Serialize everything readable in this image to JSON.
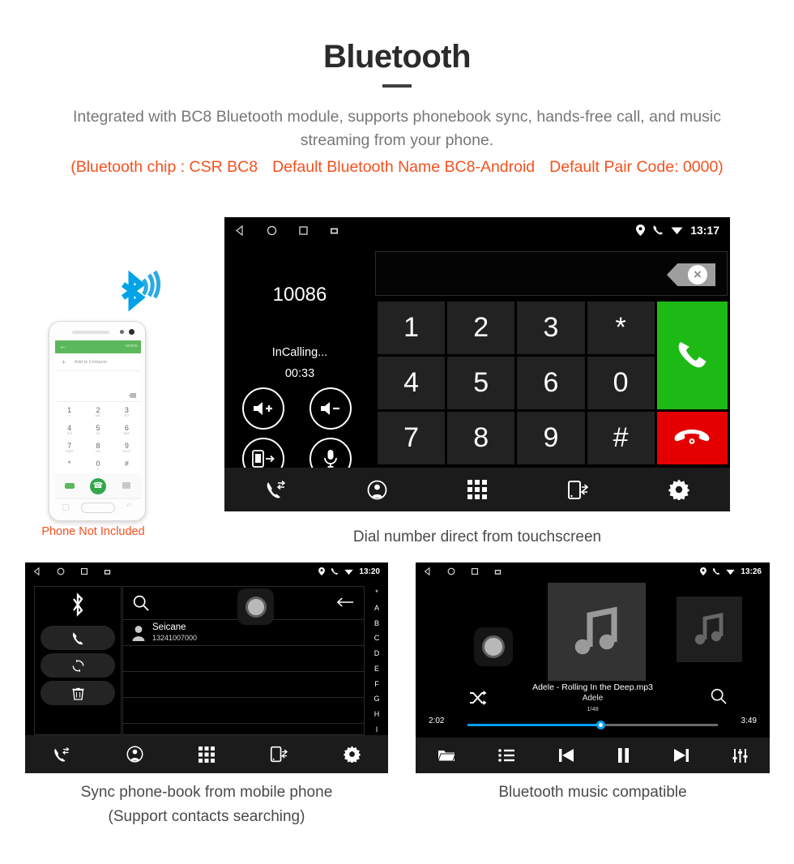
{
  "header": {
    "title": "Bluetooth",
    "description": "Integrated with BC8 Bluetooth module, supports phonebook sync, hands-free call, and music streaming from your phone.",
    "spec_part1": "(Bluetooth chip : CSR BC8",
    "spec_part2": "Default Bluetooth Name BC8-Android",
    "spec_part3": "Default Pair Code: 0000)",
    "accent_color": "#f4511e",
    "text_color": "#777777"
  },
  "phone_mockup": {
    "caption": "Phone Not Included",
    "screen": {
      "more_label": "MORE",
      "back_glyph": "←",
      "add_contact_plus": "+",
      "add_contact_label": "Add to Contacts",
      "keys": [
        {
          "digit": "1",
          "sub": "∞"
        },
        {
          "digit": "2",
          "sub": "ABC"
        },
        {
          "digit": "3",
          "sub": "DEF"
        },
        {
          "digit": "4",
          "sub": "GHI"
        },
        {
          "digit": "5",
          "sub": "JKL"
        },
        {
          "digit": "6",
          "sub": "MNO"
        },
        {
          "digit": "7",
          "sub": "PQRS"
        },
        {
          "digit": "8",
          "sub": "TUV"
        },
        {
          "digit": "9",
          "sub": "WXYZ"
        },
        {
          "digit": "*",
          "sub": ""
        },
        {
          "digit": "0",
          "sub": "+"
        },
        {
          "digit": "#",
          "sub": ""
        }
      ]
    }
  },
  "dial_screen": {
    "caption": "Dial number direct from touchscreen",
    "statusbar": {
      "time": "13:17",
      "icons": [
        "back-icon",
        "home-icon",
        "recents-icon",
        "screenshot-icon"
      ],
      "tray": [
        "location-icon",
        "phone-icon",
        "wifi-icon"
      ]
    },
    "number": "10086",
    "call_state": "InCalling...",
    "call_timer": "00:33",
    "controls": [
      "volume-up",
      "volume-down",
      "transfer-to-phone",
      "mute-mic"
    ],
    "keypad": [
      [
        "1",
        "2",
        "3",
        "*"
      ],
      [
        "4",
        "5",
        "6",
        "0"
      ],
      [
        "7",
        "8",
        "9",
        "#"
      ]
    ],
    "call_button": "call-icon",
    "end_button": "end-call-icon",
    "colors": {
      "call": "#1db914",
      "end": "#e40000",
      "key": "#222222"
    },
    "nav": [
      "call-log-icon",
      "contacts-icon",
      "keypad-icon",
      "phone-sync-icon",
      "settings-icon"
    ]
  },
  "phonebook_screen": {
    "caption_line1": "Sync phone-book from mobile phone",
    "caption_line2": "(Support contacts searching)",
    "statusbar": {
      "time": "13:20"
    },
    "sidebar": [
      "bluetooth-icon",
      "call-icon",
      "sync-icon",
      "delete-icon"
    ],
    "search_placeholder": "",
    "back_glyph": "←",
    "contacts": [
      {
        "name": "Seicane",
        "number": "13241007000"
      }
    ],
    "empty_rows": 3,
    "index_letters": [
      "*",
      "A",
      "B",
      "C",
      "D",
      "E",
      "F",
      "G",
      "H",
      "I"
    ],
    "nav": [
      "call-log-icon",
      "contacts-icon",
      "keypad-icon",
      "phone-sync-icon",
      "settings-icon"
    ]
  },
  "music_screen": {
    "caption": "Bluetooth music compatible",
    "statusbar": {
      "time": "13:26"
    },
    "track_title": "Adele - Rolling In the Deep.mp3",
    "artist": "Adele",
    "track_index": "1/48",
    "elapsed": "2:02",
    "total": "3:49",
    "progress_percent": 53,
    "progress_color": "#00a0f0",
    "nav": [
      "folder-icon",
      "playlist-icon",
      "previous-icon",
      "pause-icon",
      "next-icon",
      "equalizer-icon"
    ]
  }
}
